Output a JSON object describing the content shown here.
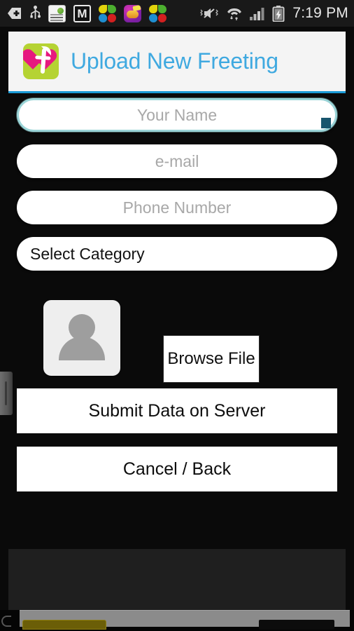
{
  "statusbar": {
    "time": "7:19 PM",
    "left_icons": [
      {
        "name": "usb-debug-plus-icon",
        "glyph": "plus-tag"
      },
      {
        "name": "usb-icon",
        "glyph": "usb"
      },
      {
        "name": "recharge-app-icon",
        "label": "AIRT RECHARGE IT"
      },
      {
        "name": "gmail-icon",
        "label": "M"
      },
      {
        "name": "flower-app-icon-1",
        "label": ""
      },
      {
        "name": "chat-app-icon",
        "label": ""
      },
      {
        "name": "flower-app-icon-2",
        "label": ""
      }
    ],
    "right_icons": [
      {
        "name": "mute-vibrate-icon",
        "glyph": "speaker-muted"
      },
      {
        "name": "wifi-icon",
        "glyph": "wifi-updown"
      },
      {
        "name": "cellular-signal-icon",
        "glyph": "signal-bars"
      },
      {
        "name": "battery-charging-icon",
        "glyph": "battery-bolt"
      }
    ]
  },
  "appbar": {
    "title": "Upload New Freeting",
    "logo_name": "freeting-logo",
    "title_color": "#3fa9e0",
    "accent_underline_color": "#1b9ad6",
    "logo_bg_color": "#b5d333",
    "logo_heart_color": "#e6187f"
  },
  "form": {
    "fields": [
      {
        "name": "name-input",
        "placeholder": "Your Name",
        "value": "",
        "focused": true,
        "align": "center"
      },
      {
        "name": "email-input",
        "placeholder": "e-mail",
        "value": "",
        "focused": false,
        "align": "center"
      },
      {
        "name": "phone-input",
        "placeholder": "Phone Number",
        "value": "",
        "focused": false,
        "align": "center"
      },
      {
        "name": "category-select",
        "placeholder": "",
        "value": "Select Category",
        "focused": false,
        "align": "left"
      }
    ]
  },
  "media": {
    "thumbnail_name": "image-preview-placeholder",
    "browse_button": "Browse File"
  },
  "actions": {
    "submit_label": "Submit Data on Server",
    "cancel_label": "Cancel / Back"
  },
  "edge": {
    "handle_name": "edge-drag-handle"
  }
}
